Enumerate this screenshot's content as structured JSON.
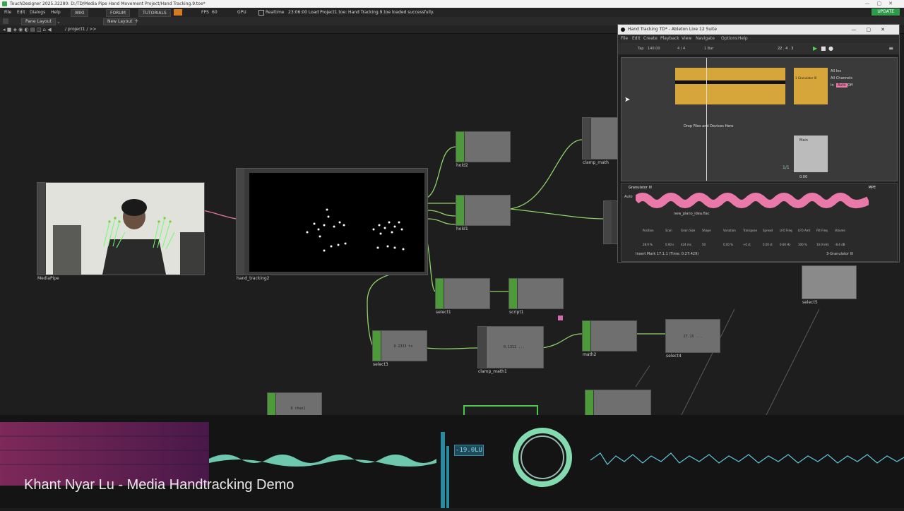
{
  "titlebar": {
    "title": "TouchDesigner 2025.32280: D:/TD/Media Pipe Hand Movement Project/Hand Tracking.9.toe*"
  },
  "menu": {
    "items": [
      "File",
      "Edit",
      "Dialogs",
      "Help"
    ],
    "wiki": "WIKI",
    "forum": "FORUM",
    "tutorials": "TUTORIALS",
    "fps_label": "FPS",
    "fps_value": "60",
    "gpu": "GPU",
    "realtime": "Realtime",
    "status": "23:06:00 Load Project1.toe: Hand Tracking.9.toe loaded successfully.",
    "update": "UPDATE"
  },
  "tabs": {
    "pane_layout": "Pane Layout",
    "new_layout": "New Layout"
  },
  "path": {
    "text": "/ project1 / >>"
  },
  "nodes": {
    "mediapipe": "MediaPipe",
    "hand_tracking2": "hand_tracking2",
    "hold2": "hold2",
    "hold1": "hold1",
    "clamp_math": "clamp_math",
    "select1": "select1",
    "script1": "script1",
    "select3": "select3",
    "clamp_math1": "clamp_math1",
    "math2": "math2",
    "select4": "select4",
    "select5": "select5",
    "chan1": "0 chan1",
    "select3_val": "0.2333 tx",
    "clamp_math1_val": "0.1311 ...",
    "select4_val": "27.15 ..."
  },
  "ableton": {
    "title": "Hand Tracking TD* - Ableton Live 12 Suite",
    "menu": [
      "File",
      "Edit",
      "Create",
      "Playback",
      "View",
      "Navigate",
      "Options",
      "Help"
    ],
    "tap": "Tap",
    "bpm": "140.00",
    "sig": "4 / 4",
    "bar": "1 Bar",
    "position": "22 . 4 . 3",
    "drop_text": "Drop Files and Devices Here",
    "track1": "1 Granulator III",
    "track_main": "Main",
    "all_ins": "All Ins",
    "all_channels": "All Channels",
    "in_label": "In",
    "auto_label": "Auto",
    "off_label": "Off",
    "device_name": "Granulator III",
    "sample": "new_piano_idea.flac",
    "insert_mark": "Insert Mark 17.1.1 (Time: 0:27:429)",
    "footer_device": "3-Granulator III",
    "mpe": "MPE",
    "knobs": [
      "Position",
      "Scan",
      "Grain Size",
      "Shape",
      "Variation",
      "Transpose",
      "Spread",
      "LFO Freq",
      "LFO Amt",
      "Filt Freq",
      "Volume"
    ],
    "knob_vals": [
      "28.9 %",
      "0.00 s",
      "424 ms",
      "50",
      "0.00 %",
      "+0 st",
      "0.00 st",
      "0.60 Hz",
      "100 %",
      "10.0 kHz",
      "-8.4 dB"
    ],
    "fraction": "1/1",
    "vals_128": "0.00"
  },
  "overlay": {
    "meter": "-19.0LU",
    "caption": "Khant Nyar Lu - Media Handtracking Demo"
  },
  "colors": {
    "node_green": "#4c9a3a",
    "clip_gold": "#d6a63a",
    "wave_pink": "#e879a8",
    "wave_cyan": "#7ee8d8",
    "update_green": "#2e9a4a"
  }
}
